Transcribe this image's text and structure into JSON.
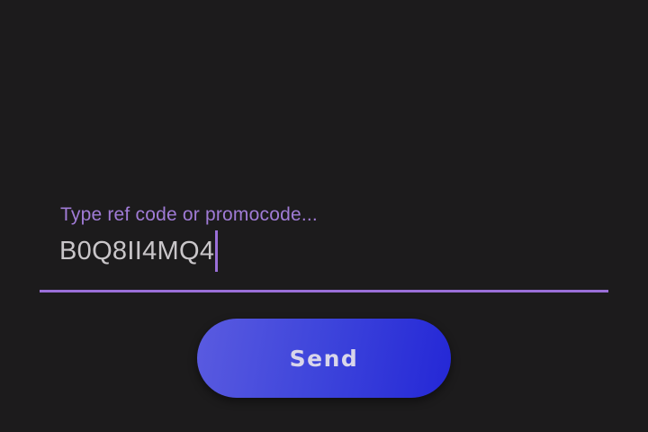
{
  "promo": {
    "placeholder_label": "Type ref code or promocode...",
    "value": "B0Q8II4MQ4"
  },
  "actions": {
    "send_label": "Send"
  },
  "colors": {
    "background": "#1c1b1c",
    "accent": "#9a6fd8",
    "button_gradient_start": "#5a5be0",
    "button_gradient_end": "#2427d6"
  }
}
